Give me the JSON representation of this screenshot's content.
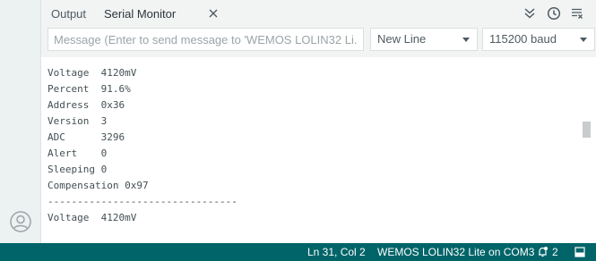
{
  "tabs": {
    "output_label": "Output",
    "serial_label": "Serial Monitor"
  },
  "toolbar": {
    "message_placeholder": "Message (Enter to send message to 'WEMOS LOLIN32 Li...",
    "line_ending": "New Line",
    "baud_rate": "115200 baud"
  },
  "serial_output": [
    "Voltage  4120mV",
    "Percent  91.6%",
    "Address  0x36",
    "Version  3",
    "ADC      3296",
    "Alert    0",
    "Sleeping 0",
    "Compensation 0x97",
    "--------------------------------",
    "Voltage  4120mV"
  ],
  "status_bar": {
    "cursor_position": "Ln 31, Col 2",
    "board_port": "WEMOS LOLIN32 Lite on COM3",
    "notifications_count": "2"
  },
  "colors": {
    "status_bar": "#006468",
    "header_bg": "#f2f4f4",
    "sidebar_bg": "#ecf1f1"
  },
  "icons": [
    "avatar-icon",
    "close-icon",
    "autoscroll-icon",
    "timestamp-icon",
    "clear-output-icon",
    "chevron-down-icon",
    "notifications-icon",
    "toggle-panel-icon"
  ]
}
